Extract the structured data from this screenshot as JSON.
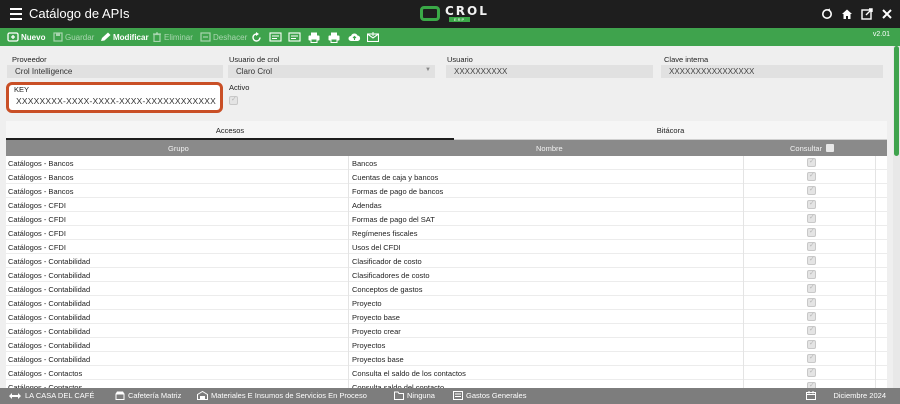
{
  "window": {
    "title": "Catálogo de APIs",
    "logo_word": "CROL",
    "logo_sub": "ERP",
    "icons": [
      "refresh-icon",
      "home-icon",
      "export-icon",
      "close-icon"
    ]
  },
  "toolbar": {
    "nuevo": "Nuevo",
    "guardar": "Guardar",
    "modificar": "Modificar",
    "eliminar": "Eliminar",
    "deshacer": "Deshacer",
    "version": "v2.01",
    "accent": "#3fa34d"
  },
  "form": {
    "proveedor_label": "Proveedor",
    "proveedor_value": "Crol Intelligence",
    "usuario_crol_label": "Usuario de crol",
    "usuario_crol_value": "Claro Crol",
    "usuario_label": "Usuario",
    "usuario_value": "XXXXXXXXXX",
    "clave_label": "Clave interna",
    "clave_value": "XXXXXXXXXXXXXXXX",
    "key_label": "KEY",
    "key_value": "XXXXXXXX-XXXX-XXXX-XXXX-XXXXXXXXXXXX",
    "activo_label": "Activo"
  },
  "tabs": {
    "accesos": "Accesos",
    "bitacora": "Bitácora"
  },
  "grid": {
    "col_grupo": "Grupo",
    "col_nombre": "Nombre",
    "col_consultar": "Consultar",
    "rows": [
      {
        "grupo": "Catálogos - Bancos",
        "nombre": "Bancos"
      },
      {
        "grupo": "Catálogos - Bancos",
        "nombre": "Cuentas de caja y bancos"
      },
      {
        "grupo": "Catálogos - Bancos",
        "nombre": "Formas de pago de bancos"
      },
      {
        "grupo": "Catálogos - CFDI",
        "nombre": "Adendas"
      },
      {
        "grupo": "Catálogos - CFDI",
        "nombre": "Formas de pago del SAT"
      },
      {
        "grupo": "Catálogos - CFDI",
        "nombre": "Regímenes fiscales"
      },
      {
        "grupo": "Catálogos - CFDI",
        "nombre": "Usos del CFDI"
      },
      {
        "grupo": "Catálogos - Contabilidad",
        "nombre": "Clasificador de costo"
      },
      {
        "grupo": "Catálogos - Contabilidad",
        "nombre": "Clasificadores de costo"
      },
      {
        "grupo": "Catálogos - Contabilidad",
        "nombre": "Conceptos de gastos"
      },
      {
        "grupo": "Catálogos - Contabilidad",
        "nombre": "Proyecto"
      },
      {
        "grupo": "Catálogos - Contabilidad",
        "nombre": "Proyecto base"
      },
      {
        "grupo": "Catálogos - Contabilidad",
        "nombre": "Proyecto crear"
      },
      {
        "grupo": "Catálogos - Contabilidad",
        "nombre": "Proyectos"
      },
      {
        "grupo": "Catálogos - Contabilidad",
        "nombre": "Proyectos base"
      },
      {
        "grupo": "Catálogos - Contactos",
        "nombre": "Consulta el saldo de los contactos"
      },
      {
        "grupo": "Catálogos - Contactos",
        "nombre": "Consulta saldo del contacto"
      }
    ]
  },
  "statusbar": {
    "empresa": "LA CASA DEL CAFÉ",
    "sucursal": "Cafetería Matriz",
    "almacen": "Materiales E Insumos de Servicios En Proceso",
    "proyecto": "Ninguna",
    "gasto": "Gastos Generales",
    "periodo": "Diciembre 2024"
  }
}
